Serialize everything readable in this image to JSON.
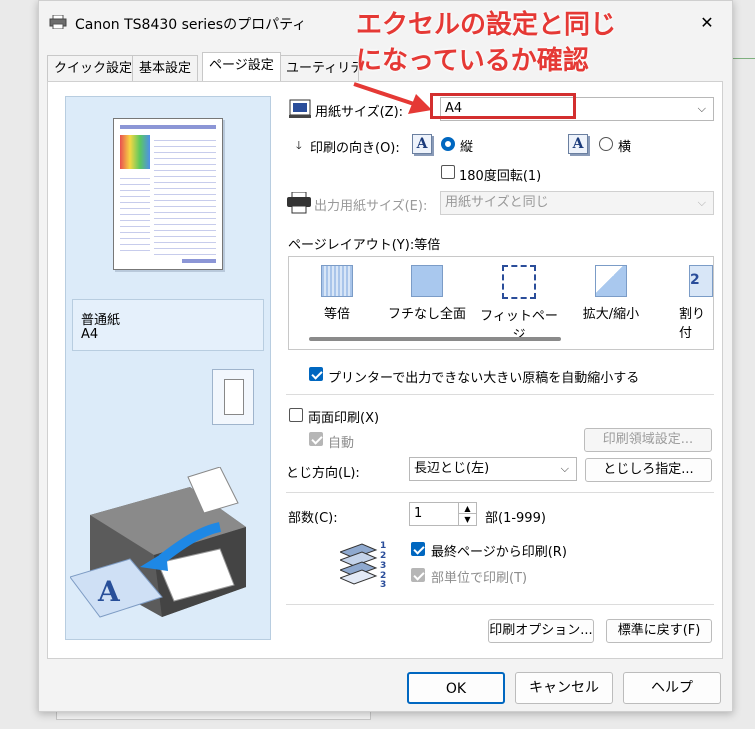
{
  "window": {
    "title": "Canon TS8430 seriesのプロパティ",
    "close_glyph": "✕"
  },
  "tabs": [
    {
      "label": "クイック設定"
    },
    {
      "label": "基本設定"
    },
    {
      "label": "ページ設定"
    },
    {
      "label": "ユーティリティ"
    }
  ],
  "annotation": {
    "line1": "エクセルの設定と同じ",
    "line2": "になっているか確認",
    "color": "#e53935"
  },
  "preview": {
    "media_type": "普通紙",
    "paper_size": "A4"
  },
  "paper_size": {
    "label": "用紙サイズ(Z):",
    "value": "A4"
  },
  "orientation": {
    "label": "印刷の向き(O):",
    "portrait": "縦",
    "landscape": "横",
    "rotate180": "180度回転(1)",
    "icon_letter": "A"
  },
  "output_size": {
    "label": "出力用紙サイズ(E):",
    "value": "用紙サイズと同じ"
  },
  "page_layout": {
    "label": "ページレイアウト(Y):等倍",
    "items": [
      {
        "label": "等倍"
      },
      {
        "label": "フチなし全面"
      },
      {
        "label": "フィットページ"
      },
      {
        "label": "拡大/縮小"
      },
      {
        "label": "割り付"
      }
    ]
  },
  "auto_reduce": {
    "label": "プリンターで出力できない大きい原稿を自動縮小する"
  },
  "duplex": {
    "label": "両面印刷(X)",
    "auto": "自動",
    "area_button": "印刷領域設定..."
  },
  "binding": {
    "label": "とじ方向(L):",
    "value": "長辺とじ(左)",
    "margin_button": "とじしろ指定..."
  },
  "copies": {
    "label": "部数(C):",
    "value": "1",
    "range": "部(1-999)",
    "reverse": "最終ページから印刷(R)",
    "collate": "部単位で印刷(T)"
  },
  "footer": {
    "options_button": "印刷オプション...",
    "defaults_button": "標準に戻す(F)"
  },
  "dialog_buttons": {
    "ok": "OK",
    "cancel": "キャンセル",
    "help": "ヘルプ"
  },
  "colors": {
    "accent": "#0067c0",
    "highlight_box": "#d32f2f",
    "preview_bg": "#dcebf9"
  }
}
